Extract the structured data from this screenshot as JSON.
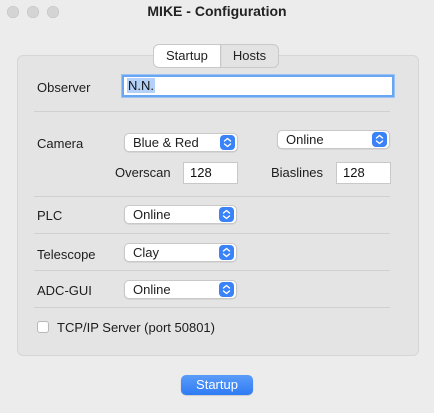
{
  "window": {
    "title": "MIKE - Configuration",
    "colors": {
      "accent": "#3a82f7",
      "panel": "#e4e4e4",
      "background": "#ececec"
    }
  },
  "tabs": [
    {
      "label": "Startup",
      "selected": true
    },
    {
      "label": "Hosts",
      "selected": false
    }
  ],
  "observer": {
    "label": "Observer",
    "value": "N.N."
  },
  "camera": {
    "label": "Camera",
    "mode_value": "Blue & Red",
    "status_value": "Online",
    "overscan_label": "Overscan",
    "overscan_value": "128",
    "biaslines_label": "Biaslines",
    "biaslines_value": "128"
  },
  "plc": {
    "label": "PLC",
    "value": "Online"
  },
  "telescope": {
    "label": "Telescope",
    "value": "Clay"
  },
  "adc_gui": {
    "label": "ADC-GUI",
    "value": "Online"
  },
  "tcpip": {
    "label": "TCP/IP Server (port 50801)",
    "checked": false
  },
  "actions": {
    "startup_label": "Startup"
  }
}
